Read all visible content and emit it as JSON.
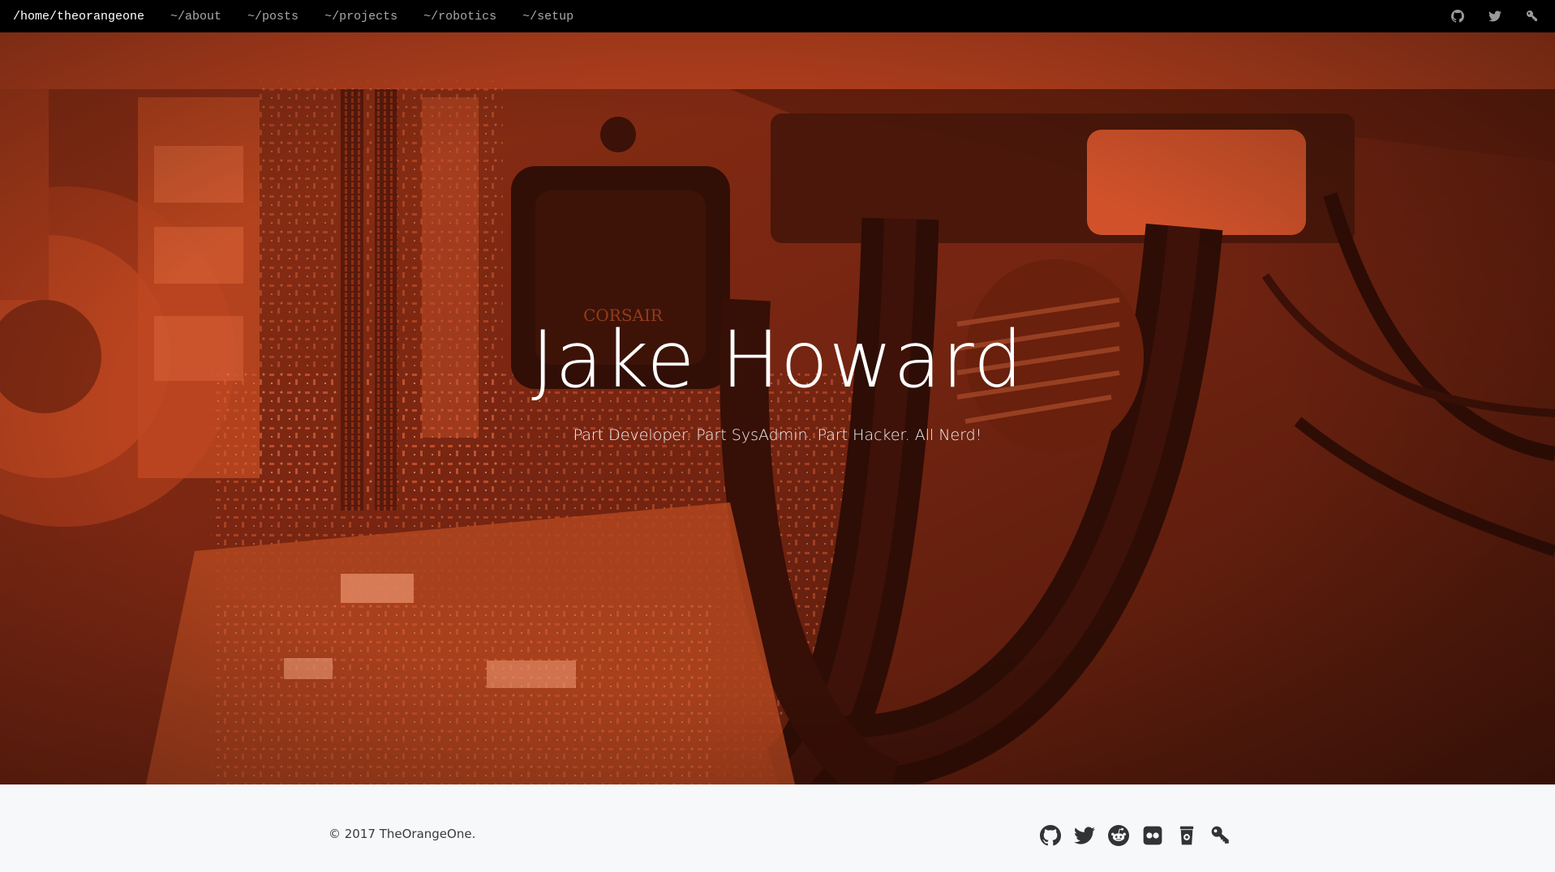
{
  "nav": {
    "brand": "/home/theorangeone",
    "links": [
      {
        "label": "~/about"
      },
      {
        "label": "~/posts"
      },
      {
        "label": "~/projects"
      },
      {
        "label": "~/robotics"
      },
      {
        "label": "~/setup"
      }
    ],
    "icons": [
      "github-icon",
      "twitter-icon",
      "key-icon"
    ]
  },
  "hero": {
    "title": "Jake Howard",
    "subtitle": "Part Developer. Part SysAdmin. Part Hacker. All Nerd!",
    "tint_color": "#c0411f"
  },
  "footer": {
    "copyright": "© 2017 TheOrangeOne.",
    "icons": [
      "github-icon",
      "twitter-icon",
      "reddit-icon",
      "flickr-icon",
      "tip-jar-icon",
      "key-icon"
    ]
  },
  "colors": {
    "navbar_bg": "#000000",
    "footer_bg": "#f7f8fa"
  }
}
